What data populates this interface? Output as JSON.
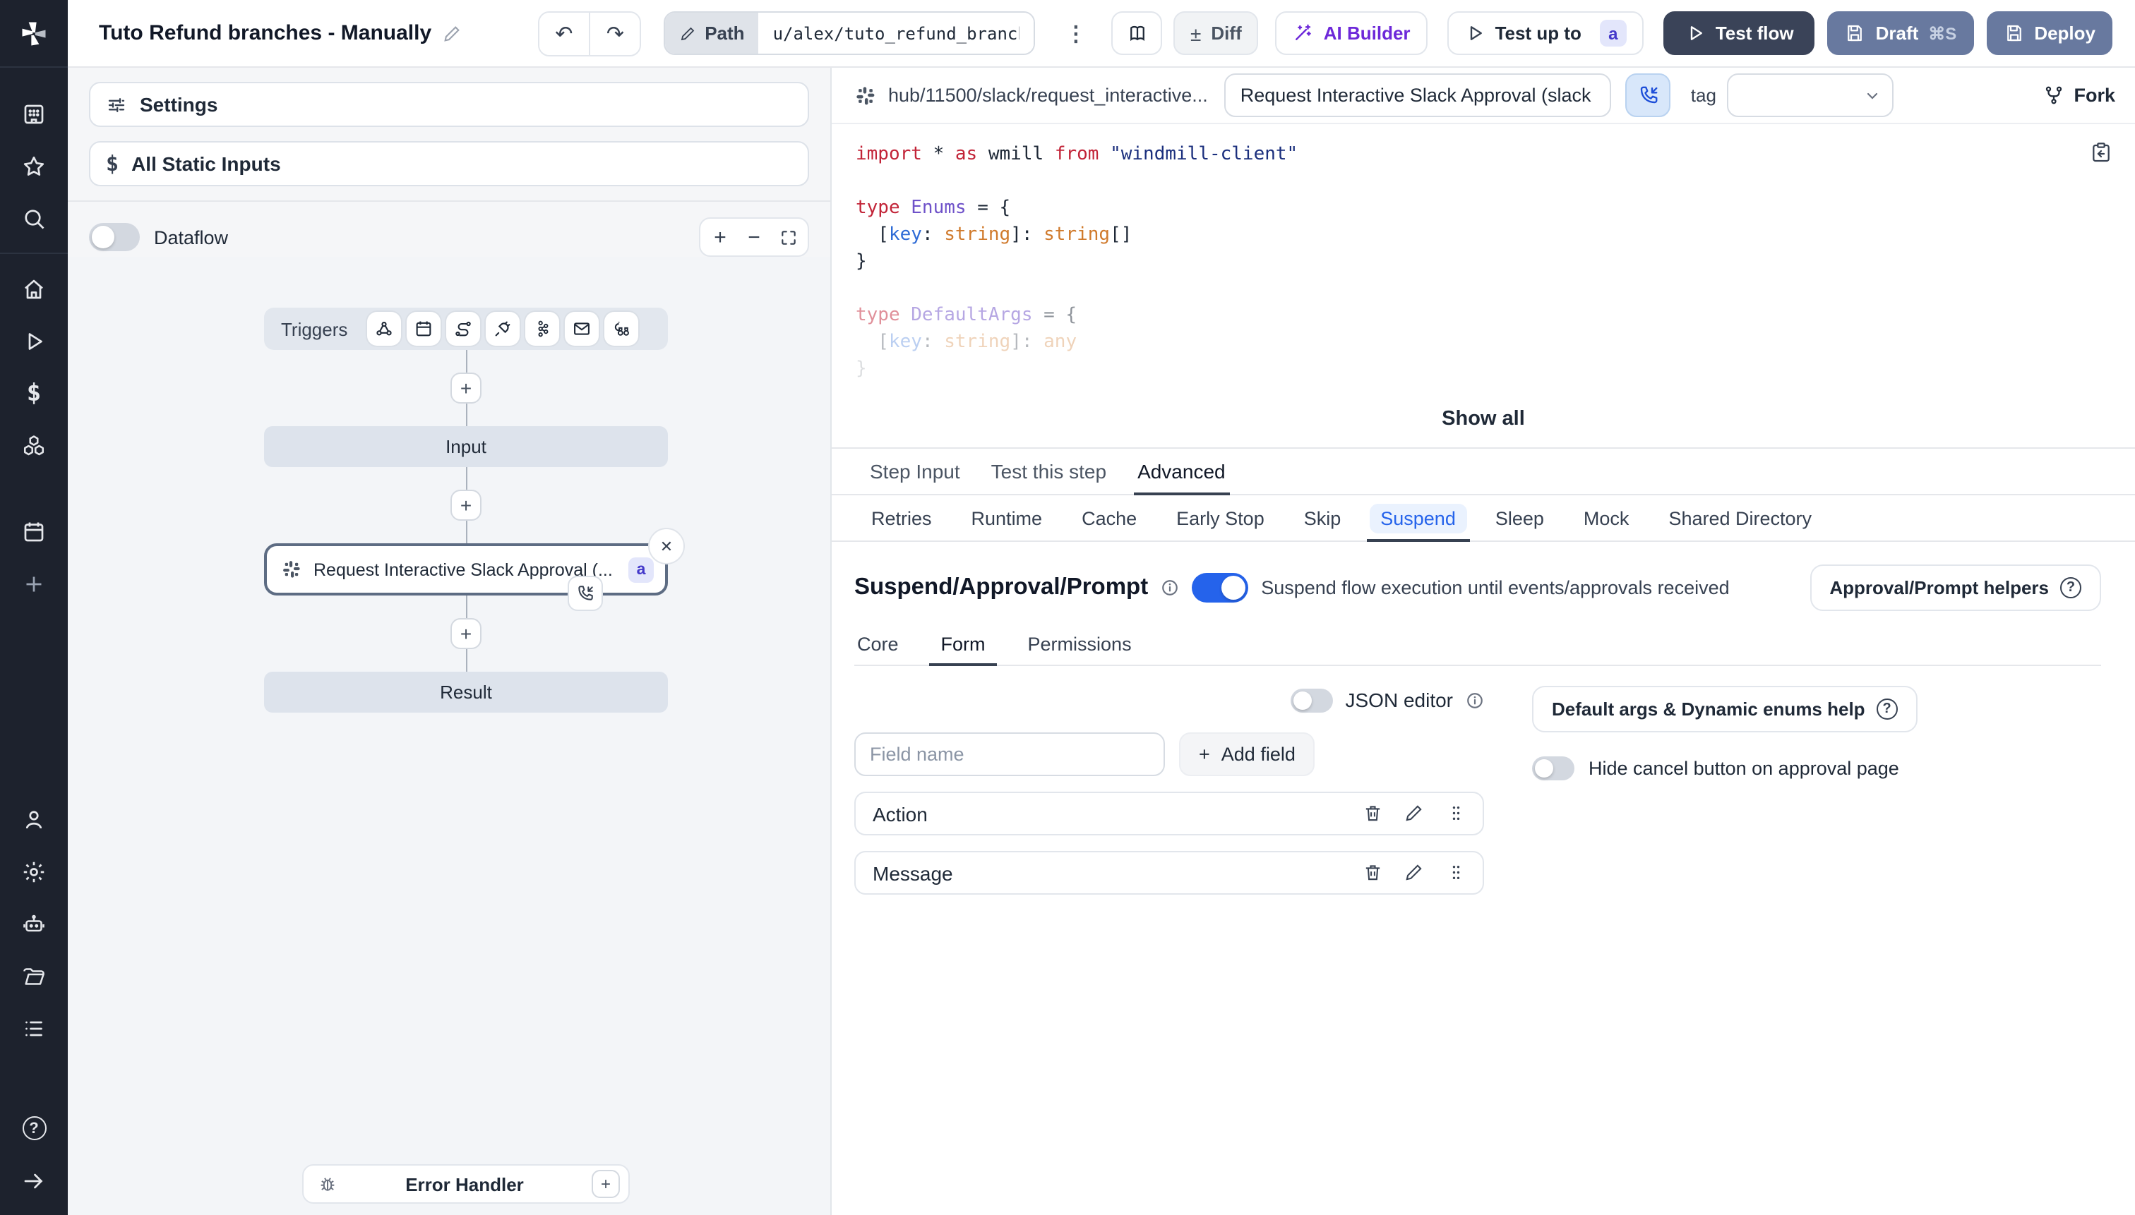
{
  "topbar": {
    "title": "Tuto Refund branches - Manually",
    "path_label": "Path",
    "path_value": "u/alex/tuto_refund_branches__",
    "diff_label": "Diff",
    "ai_builder_label": "AI Builder",
    "test_up_to_label": "Test up to",
    "test_up_to_badge": "a",
    "test_flow_label": "Test flow",
    "draft_label": "Draft",
    "draft_shortcut": "⌘S",
    "deploy_label": "Deploy"
  },
  "left_panel": {
    "settings_label": "Settings",
    "static_inputs_label": "All Static Inputs",
    "dataflow_label": "Dataflow",
    "graph": {
      "triggers_label": "Triggers",
      "input_label": "Input",
      "step_label": "Request Interactive Slack Approval (...",
      "step_badge": "a",
      "result_label": "Result",
      "error_handler_label": "Error Handler"
    }
  },
  "right_panel": {
    "header": {
      "hub_path": "hub/11500/slack/request_interactive...",
      "summary_value": "Request Interactive Slack Approval (slack",
      "tag_label": "tag",
      "fork_label": "Fork"
    },
    "editor": {
      "show_all_label": "Show all",
      "lines": [
        {
          "tokens": [
            {
              "t": "import",
              "c": "kw"
            },
            {
              "t": " * ",
              "c": "pl"
            },
            {
              "t": "as",
              "c": "kw"
            },
            {
              "t": " wmill ",
              "c": "pl"
            },
            {
              "t": "from",
              "c": "kw"
            },
            {
              "t": " ",
              "c": "pl"
            },
            {
              "t": "\"windmill-client\"",
              "c": "str"
            }
          ]
        },
        {
          "tokens": []
        },
        {
          "tokens": [
            {
              "t": "type",
              "c": "kw"
            },
            {
              "t": " ",
              "c": "pl"
            },
            {
              "t": "Enums",
              "c": "ty"
            },
            {
              "t": " = {",
              "c": "pl"
            }
          ]
        },
        {
          "tokens": [
            {
              "t": "  [",
              "c": "pl"
            },
            {
              "t": "key",
              "c": "key"
            },
            {
              "t": ": ",
              "c": "pl"
            },
            {
              "t": "string",
              "c": "st2"
            },
            {
              "t": "]: ",
              "c": "pl"
            },
            {
              "t": "string",
              "c": "st2"
            },
            {
              "t": "[]",
              "c": "pl"
            }
          ]
        },
        {
          "tokens": [
            {
              "t": "}",
              "c": "pl"
            }
          ]
        },
        {
          "tokens": []
        },
        {
          "fade": 0.5,
          "tokens": [
            {
              "t": "type",
              "c": "kw"
            },
            {
              "t": " ",
              "c": "pl"
            },
            {
              "t": "DefaultArgs",
              "c": "ty"
            },
            {
              "t": " = {",
              "c": "pl"
            }
          ]
        },
        {
          "fade": 0.32,
          "tokens": [
            {
              "t": "  [",
              "c": "pl"
            },
            {
              "t": "key",
              "c": "key"
            },
            {
              "t": ": ",
              "c": "pl"
            },
            {
              "t": "string",
              "c": "st2"
            },
            {
              "t": "]: ",
              "c": "pl"
            },
            {
              "t": "any",
              "c": "st2"
            }
          ]
        },
        {
          "fade": 0.15,
          "tokens": [
            {
              "t": "}",
              "c": "pl"
            }
          ]
        }
      ]
    },
    "tabs": [
      "Step Input",
      "Test this step",
      "Advanced"
    ],
    "active_tab": "Advanced",
    "subtabs": [
      "Retries",
      "Runtime",
      "Cache",
      "Early Stop",
      "Skip",
      "Suspend",
      "Sleep",
      "Mock",
      "Shared Directory"
    ],
    "active_subtab": "Suspend",
    "suspend": {
      "title": "Suspend/Approval/Prompt",
      "toggle_caption": "Suspend flow execution until events/approvals received",
      "helpers_label": "Approval/Prompt helpers",
      "inner_tabs": [
        "Core",
        "Form",
        "Permissions"
      ],
      "active_inner_tab": "Form",
      "json_editor_label": "JSON editor",
      "field_name_placeholder": "Field name",
      "add_field_label": "Add field",
      "fields": [
        "Action",
        "Message"
      ],
      "default_args_help_label": "Default args & Dynamic enums help",
      "hide_cancel_label": "Hide cancel button on approval page"
    }
  },
  "colors": {
    "primary_blue": "#2563eb",
    "dark_button": "#3a4358",
    "slate_button": "#68799f",
    "ai_purple": "#6d28d9",
    "badge_bg": "#e3e6fb",
    "badge_text": "#4338ca",
    "sidebar_bg": "#1d222d",
    "active_subtab_blue": "#2563eb"
  }
}
